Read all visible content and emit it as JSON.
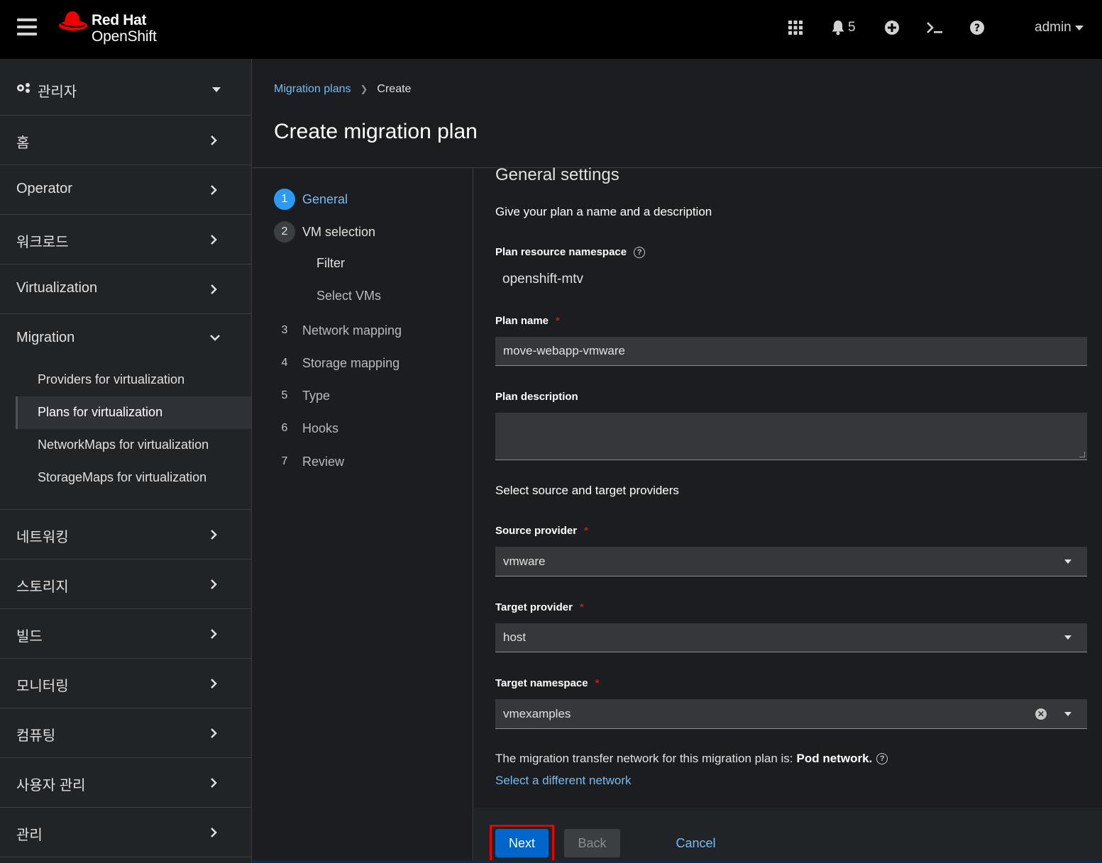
{
  "masthead": {
    "brand_line1": "Red Hat",
    "brand_line2": "OpenShift",
    "notification_count": "5",
    "user": "admin",
    "icons": [
      "hamburger-icon",
      "apps-grid-icon",
      "bell-icon",
      "plus-circle-icon",
      "terminal-icon",
      "help-icon"
    ]
  },
  "sidebar": {
    "perspective": "관리자",
    "items_top": [
      {
        "label": "홈"
      },
      {
        "label": "Operator"
      },
      {
        "label": "워크로드"
      },
      {
        "label": "Virtualization"
      }
    ],
    "migration": {
      "label": "Migration",
      "subitems": [
        {
          "label": "Providers for virtualization"
        },
        {
          "label": "Plans for virtualization"
        },
        {
          "label": "NetworkMaps for virtualization"
        },
        {
          "label": "StorageMaps for virtualization"
        }
      ]
    },
    "items_bottom": [
      {
        "label": "네트워킹"
      },
      {
        "label": "스토리지"
      },
      {
        "label": "빌드"
      },
      {
        "label": "모니터링"
      },
      {
        "label": "컴퓨팅"
      },
      {
        "label": "사용자 관리"
      },
      {
        "label": "관리"
      }
    ]
  },
  "breadcrumb": {
    "link": "Migration plans",
    "current": "Create"
  },
  "page_title": "Create migration plan",
  "wizard": {
    "steps": [
      {
        "num": "1",
        "label": "General"
      },
      {
        "num": "2",
        "label": "VM selection"
      },
      {
        "num": "3",
        "label": "Network mapping"
      },
      {
        "num": "4",
        "label": "Storage mapping"
      },
      {
        "num": "5",
        "label": "Type"
      },
      {
        "num": "6",
        "label": "Hooks"
      },
      {
        "num": "7",
        "label": "Review"
      }
    ],
    "substeps": [
      {
        "label": "Filter"
      },
      {
        "label": "Select VMs"
      }
    ]
  },
  "form": {
    "section_title": "General settings",
    "subheading1": "Give your plan a name and a description",
    "namespace_label": "Plan resource namespace",
    "namespace_value": "openshift-mtv",
    "plan_name_label": "Plan name",
    "plan_name_value": "move-webapp-vmware",
    "plan_description_label": "Plan description",
    "plan_description_value": "",
    "subheading2": "Select source and target providers",
    "source_label": "Source provider",
    "source_value": "vmware",
    "target_label": "Target provider",
    "target_value": "host",
    "target_ns_label": "Target namespace",
    "target_ns_value": "vmexamples",
    "required_marker": "*",
    "network_text": "The migration transfer network for this migration plan is:",
    "network_value": "Pod network.",
    "network_link": "Select a different network"
  },
  "footer": {
    "next": "Next",
    "back": "Back",
    "cancel": "Cancel"
  },
  "colors": {
    "accent": "#2b9af3",
    "link": "#73bcf7",
    "primary_button": "#0066cc",
    "required": "#c9190b",
    "highlight_frame": "#ee0000"
  }
}
